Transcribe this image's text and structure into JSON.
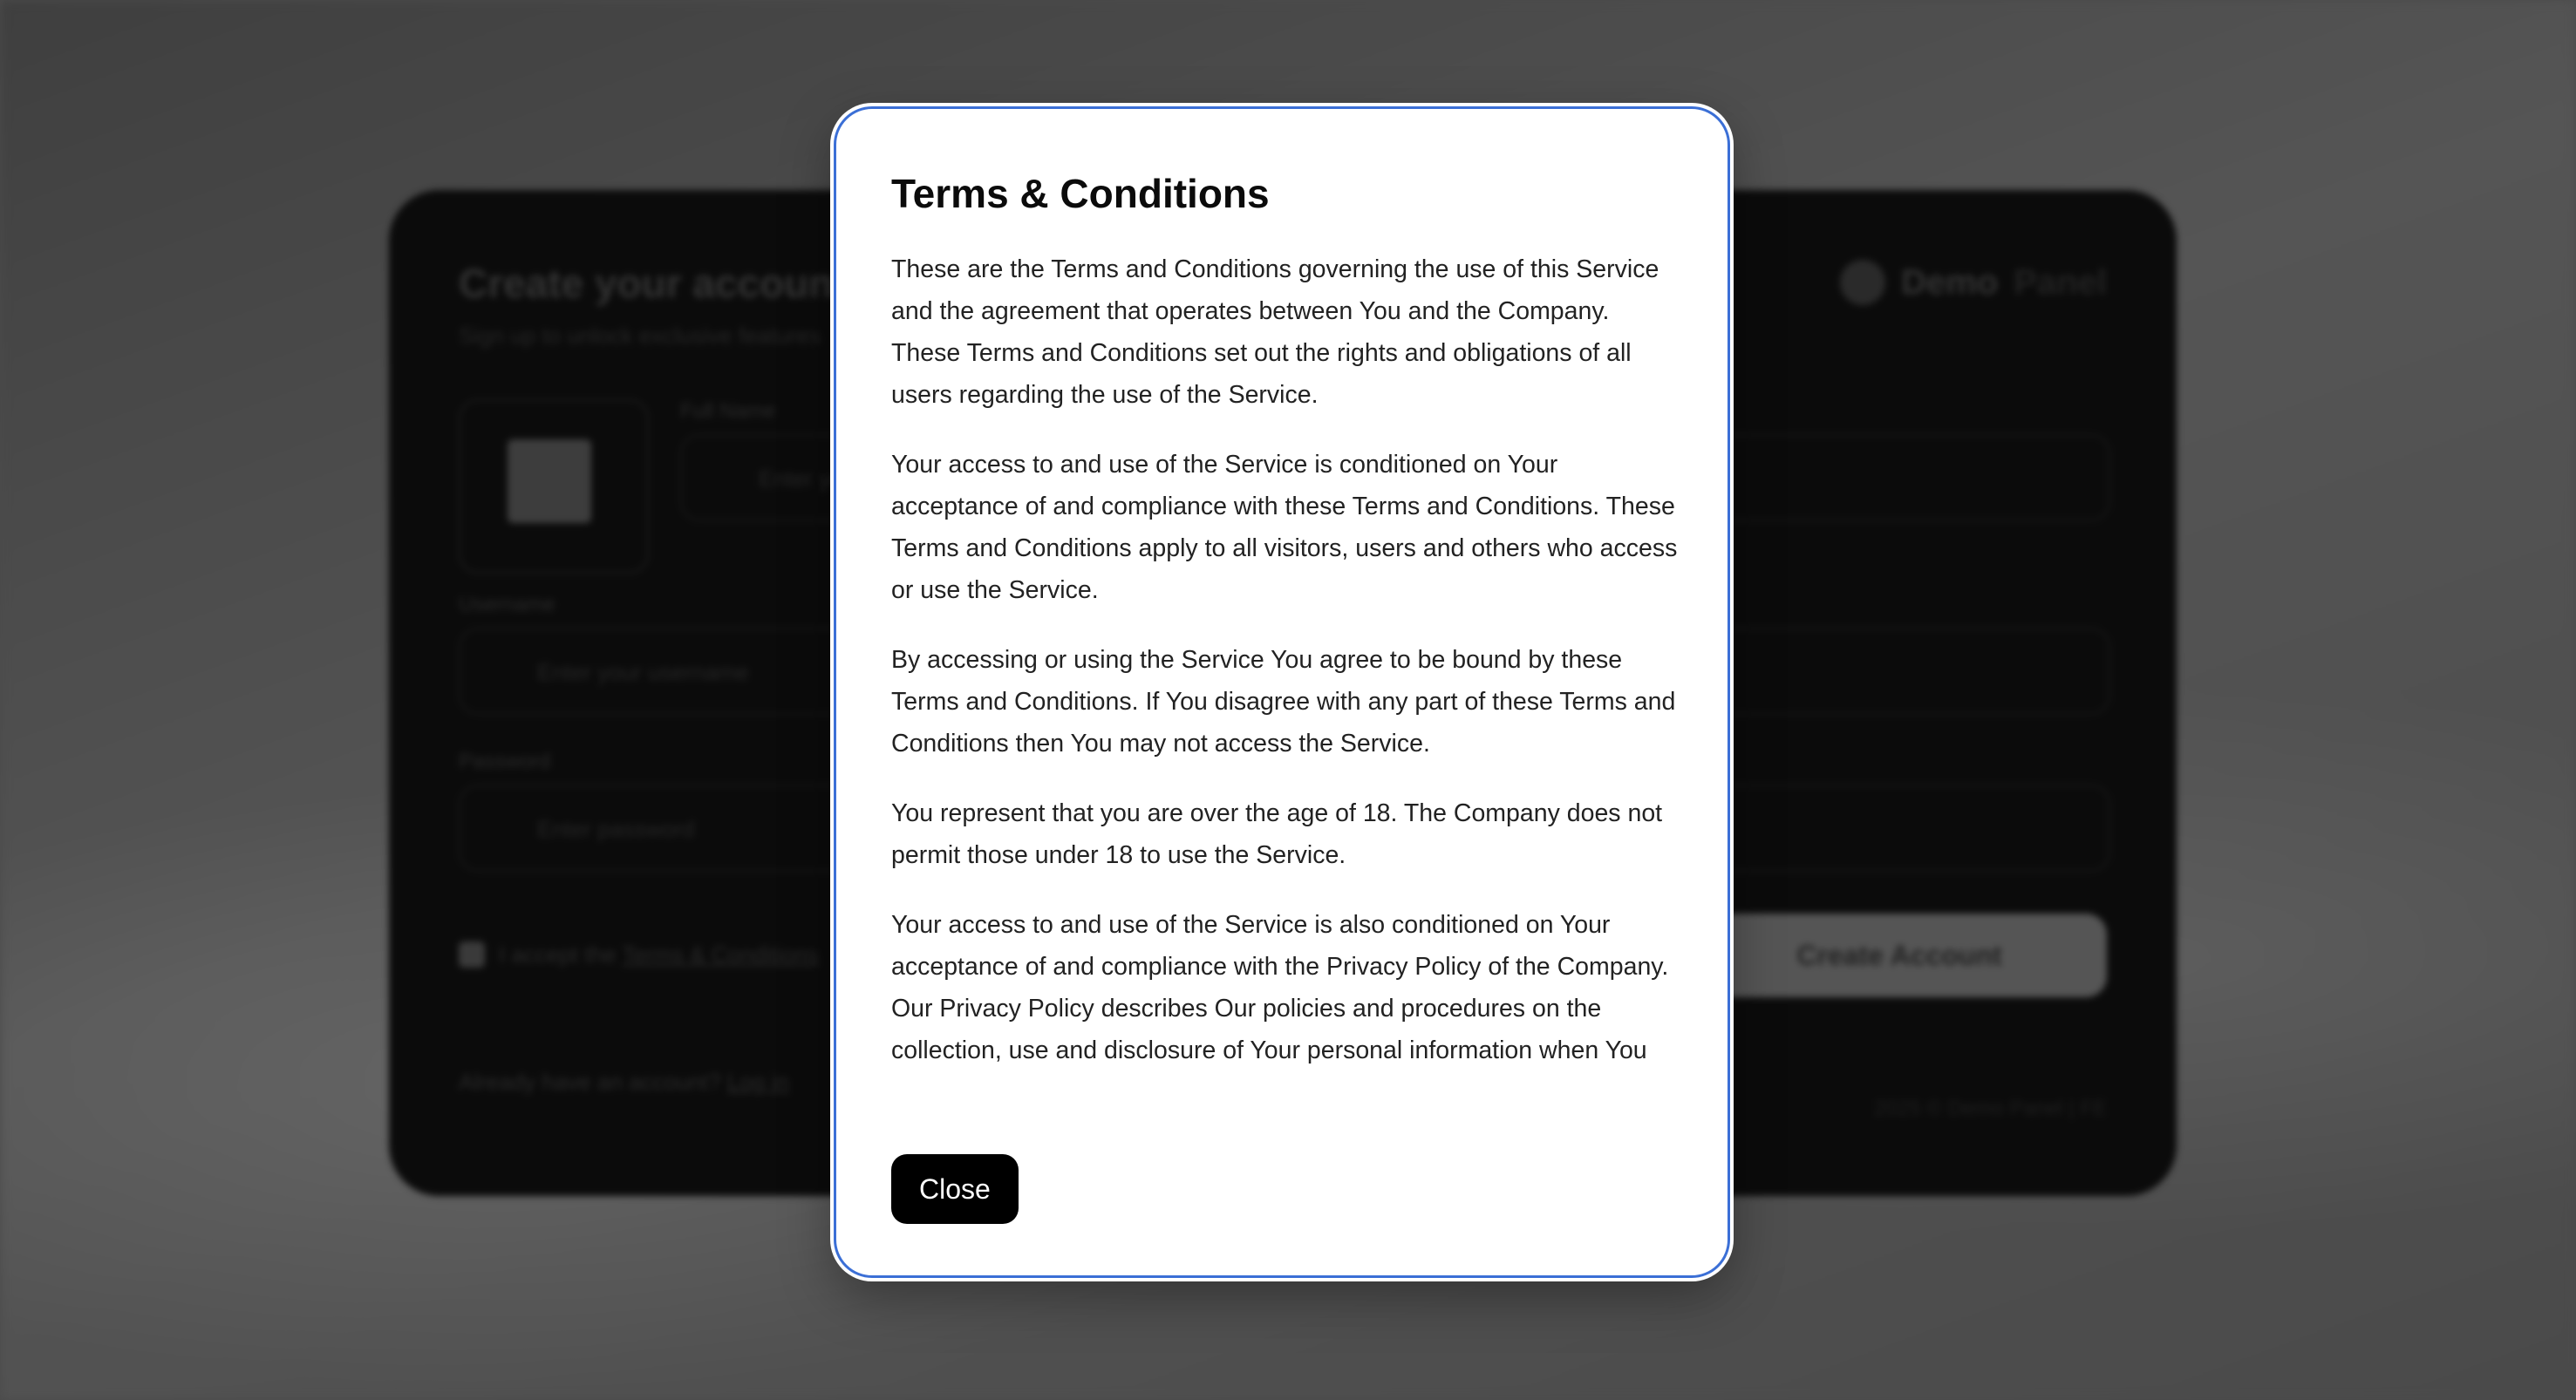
{
  "background_card": {
    "title": "Create your account",
    "subtitle": "Sign up to unlock exclusive features",
    "brand_name": "Demo",
    "brand_suffix": "Panel",
    "full_name_label": "Full Name",
    "full_name_placeholder": "Enter your full name",
    "username_label": "Username",
    "username_placeholder": "Enter your username",
    "password_label": "Password",
    "password_placeholder": "Enter password",
    "accept_prefix": "I accept the",
    "accept_link": "Terms & Conditions",
    "create_button": "Create Account",
    "login_prompt": "Already have an account?",
    "login_link": "Log in",
    "footer": "2025 © Demo Panel | FE"
  },
  "modal": {
    "title": "Terms & Conditions",
    "paragraphs": [
      "These are the Terms and Conditions governing the use of this Service and the agreement that operates between You and the Company. These Terms and Conditions set out the rights and obligations of all users regarding the use of the Service.",
      "Your access to and use of the Service is conditioned on Your acceptance of and compliance with these Terms and Conditions. These Terms and Conditions apply to all visitors, users and others who access or use the Service.",
      "By accessing or using the Service You agree to be bound by these Terms and Conditions. If You disagree with any part of these Terms and Conditions then You may not access the Service.",
      "You represent that you are over the age of 18. The Company does not permit those under 18 to use the Service.",
      "Your access to and use of the Service is also conditioned on Your acceptance of and compliance with the Privacy Policy of the Company. Our Privacy Policy describes Our policies and procedures on the collection, use and disclosure of Your personal information when You use the Application or the Website and tells You about Your"
    ],
    "close_label": "Close"
  }
}
